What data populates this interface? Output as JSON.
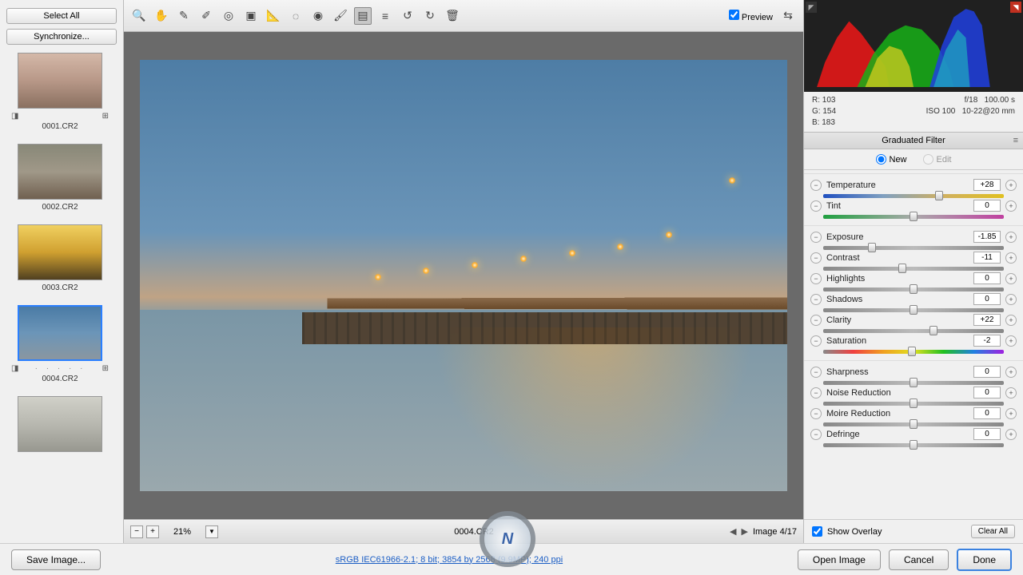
{
  "left": {
    "select_all": "Select All",
    "synchronize": "Synchronize...",
    "thumbs": [
      {
        "file": "0001.CR2"
      },
      {
        "file": "0002.CR2"
      },
      {
        "file": "0003.CR2"
      },
      {
        "file": "0004.CR2"
      },
      {
        "file": ""
      }
    ],
    "selected_index": 3
  },
  "toolbar": {
    "preview_label": "Preview",
    "preview_checked": true
  },
  "canvas": {
    "zoom": "21%",
    "filename": "0004.CR2",
    "image_pos": "Image 4/17"
  },
  "status": {
    "save_image": "Save Image...",
    "link_text": "sRGB IEC61966-2.1; 8 bit; 3854 by 2568 (9.9MP); 240 ppi",
    "open_image": "Open Image",
    "cancel": "Cancel",
    "done": "Done"
  },
  "info": {
    "r": "R:",
    "r_val": "103",
    "g": "G:",
    "g_val": "154",
    "b": "B:",
    "b_val": "183",
    "aperture": "f/18",
    "shutter": "100.00 s",
    "iso": "ISO 100",
    "lens": "10-22@20 mm"
  },
  "panel": {
    "title": "Graduated Filter",
    "new": "New",
    "edit": "Edit",
    "mode": "new",
    "show_overlay": "Show Overlay",
    "show_overlay_checked": true,
    "clear_all": "Clear All"
  },
  "sliders": {
    "groups": [
      [
        {
          "label": "Temperature",
          "value": "+28",
          "pos": 64,
          "track": "temp"
        },
        {
          "label": "Tint",
          "value": "0",
          "pos": 50,
          "track": "tint"
        }
      ],
      [
        {
          "label": "Exposure",
          "value": "-1.85",
          "pos": 27,
          "track": ""
        },
        {
          "label": "Contrast",
          "value": "-11",
          "pos": 44,
          "track": ""
        },
        {
          "label": "Highlights",
          "value": "0",
          "pos": 50,
          "track": ""
        },
        {
          "label": "Shadows",
          "value": "0",
          "pos": 50,
          "track": ""
        },
        {
          "label": "Clarity",
          "value": "+22",
          "pos": 61,
          "track": ""
        },
        {
          "label": "Saturation",
          "value": "-2",
          "pos": 49,
          "track": "sat"
        }
      ],
      [
        {
          "label": "Sharpness",
          "value": "0",
          "pos": 50,
          "track": ""
        },
        {
          "label": "Noise Reduction",
          "value": "0",
          "pos": 50,
          "track": ""
        },
        {
          "label": "Moire Reduction",
          "value": "0",
          "pos": 50,
          "track": ""
        },
        {
          "label": "Defringe",
          "value": "0",
          "pos": 50,
          "track": ""
        }
      ]
    ]
  }
}
